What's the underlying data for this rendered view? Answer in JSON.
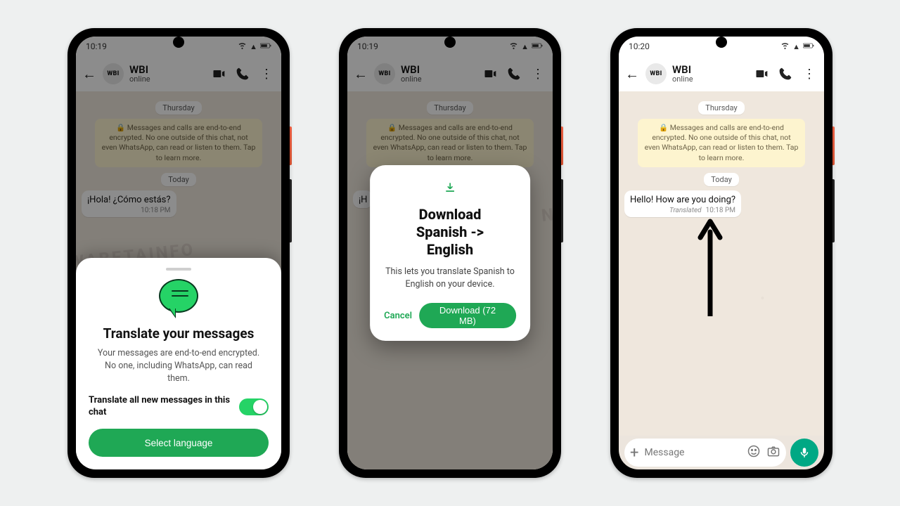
{
  "colors": {
    "accent": "#1fa855",
    "whatsapp": "#25d366",
    "mic": "#00a884"
  },
  "statusbar": {
    "time_a": "10:19",
    "time_b": "10:20",
    "wifi": "wifi",
    "signal": "signal",
    "battery": "battery"
  },
  "chat": {
    "avatar_text": "WBI",
    "title": "WBI",
    "status": "online",
    "date1": "Thursday",
    "date2": "Today",
    "encryption_notice": "🔒 Messages and calls are end-to-end encrypted. No one outside of this chat, not even WhatsApp, can read or listen to them. Tap to learn more.",
    "message_es": "¡Hola! ¿Cómo estás?",
    "message_partial": "¡H",
    "message_en": "Hello! How are you doing?",
    "message_time": "10:18 PM",
    "translated_tag": "Translated",
    "input_placeholder": "Message"
  },
  "sheet": {
    "title": "Translate your messages",
    "desc": "Your messages are end-to-end encrypted. No one, including WhatsApp, can read them.",
    "toggle_label": "Translate all new messages in this chat",
    "toggle_on": true,
    "button": "Select language"
  },
  "dialog": {
    "title_l1": "Download",
    "title_l2": "Spanish ->",
    "title_l3": "English",
    "desc": "This lets you translate Spanish to English on your device.",
    "cancel": "Cancel",
    "download": "Download (72 MB)"
  }
}
